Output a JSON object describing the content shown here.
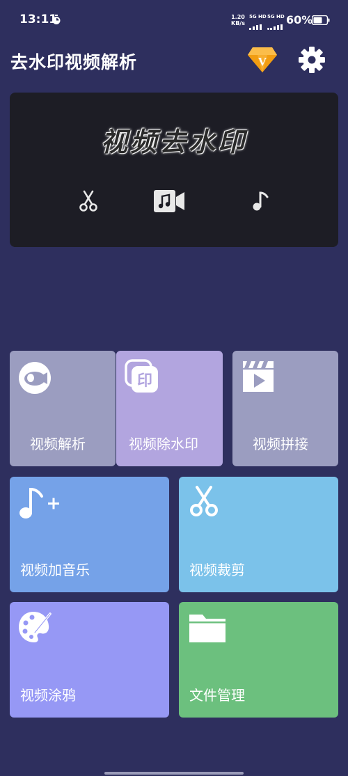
{
  "status_bar": {
    "time": "13:11",
    "net_speed_value": "1.20",
    "net_speed_unit": "KB/s",
    "signal1_label": "5G HD",
    "signal2_label": "5G HD",
    "battery_percent": "60%"
  },
  "header": {
    "title": "去水印视频解析",
    "vip_badge_letter": "V"
  },
  "banner": {
    "title": "视频去水印",
    "icons": [
      "scissors-icon",
      "video-music-icon",
      "music-note-icon"
    ]
  },
  "tiles": [
    {
      "label": "视频解析",
      "icon": "camera-icon",
      "color": "#9b9dc0"
    },
    {
      "label": "视频除水印",
      "icon": "stamp-icon",
      "color": "#b2a5df"
    },
    {
      "label": "视频拼接",
      "icon": "clapperboard-icon",
      "color": "#9b9dc0"
    },
    {
      "label": "视频加音乐",
      "icon": "music-add-icon",
      "color": "#75a2e8"
    },
    {
      "label": "视频裁剪",
      "icon": "scissors-icon",
      "color": "#7bc2ea"
    },
    {
      "label": "视频涂鸦",
      "icon": "palette-icon",
      "color": "#9698f5"
    },
    {
      "label": "文件管理",
      "icon": "folder-icon",
      "color": "#6cc07e"
    }
  ],
  "colors": {
    "background": "#2e2f5e",
    "banner": "#1d1d25",
    "vip_gold": "#f6a623"
  }
}
